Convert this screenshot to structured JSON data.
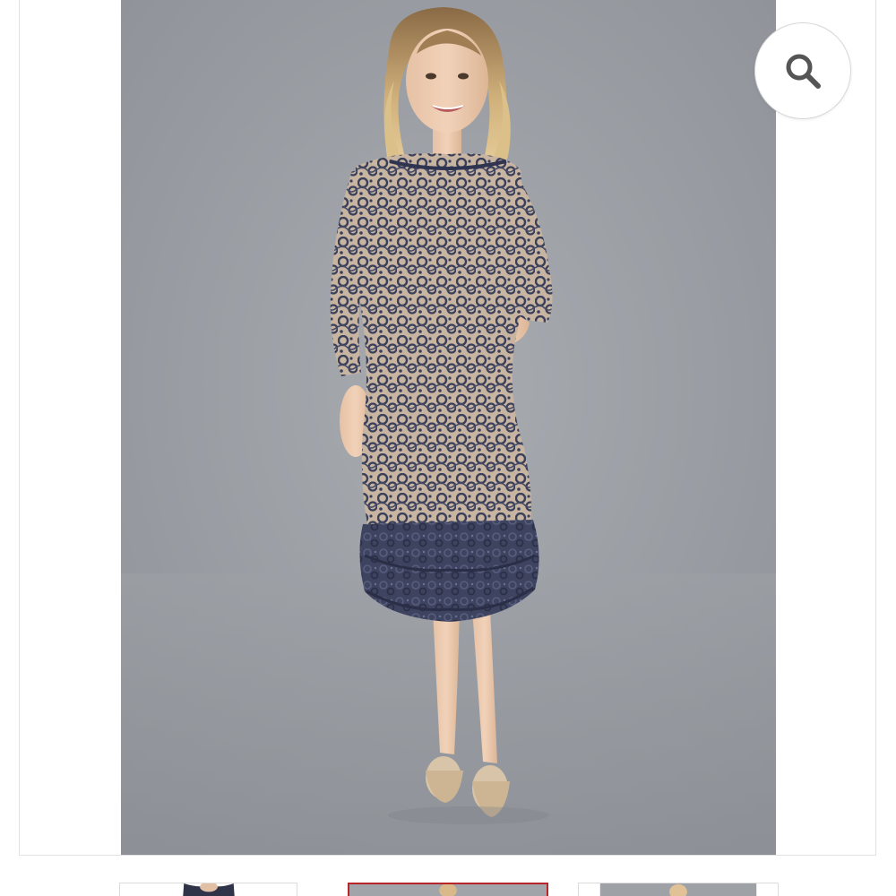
{
  "product": {
    "main_image": {
      "alt": "",
      "background_color": "#9a9ea3",
      "dress_color": "#3a3f57",
      "lining_color": "#c9b8a6"
    },
    "zoom": {
      "icon": "search-icon",
      "icon_color": "#555555"
    },
    "thumbnails": [
      {
        "selected": false
      },
      {
        "selected": true,
        "border_color": "#b8262b"
      },
      {
        "selected": false
      }
    ]
  }
}
